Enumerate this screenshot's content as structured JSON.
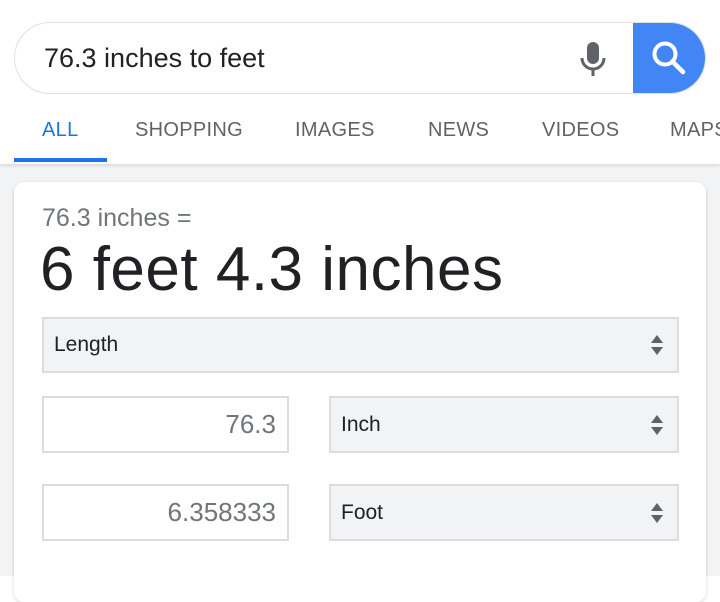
{
  "search": {
    "query": "76.3 inches to feet"
  },
  "tabs": [
    {
      "label": "ALL",
      "active": true
    },
    {
      "label": "SHOPPING",
      "active": false
    },
    {
      "label": "IMAGES",
      "active": false
    },
    {
      "label": "NEWS",
      "active": false
    },
    {
      "label": "VIDEOS",
      "active": false
    },
    {
      "label": "MAPS",
      "active": false
    }
  ],
  "converter": {
    "equation": "76.3 inches =",
    "result": "6 feet 4.3 inches",
    "unit_type": "Length",
    "from_value": "76.3",
    "from_unit": "Inch",
    "to_value": "6.358333",
    "to_unit": "Foot"
  },
  "colors": {
    "accent": "#1a73e8",
    "search_button": "#4285f4"
  },
  "icons": {
    "mic": "mic-icon",
    "search": "search-icon",
    "select_arrows": "sort-arrows-icon"
  }
}
